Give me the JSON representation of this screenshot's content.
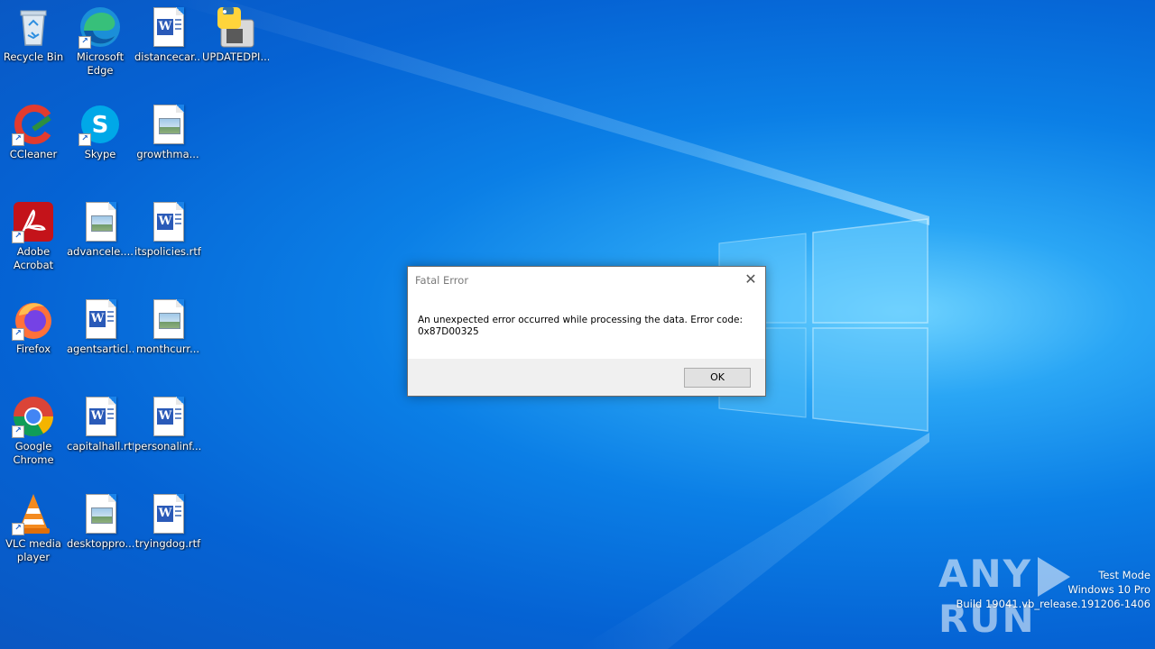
{
  "desktop": {
    "icons": [
      {
        "label": "Recycle Bin",
        "type": "recycle-bin"
      },
      {
        "label": "Microsoft\nEdge",
        "type": "edge"
      },
      {
        "label": "distancecar...",
        "type": "word"
      },
      {
        "label": "UPDATEDPI...",
        "type": "python"
      },
      {
        "label": "CCleaner",
        "type": "ccleaner"
      },
      {
        "label": "Skype",
        "type": "skype"
      },
      {
        "label": "growthma...",
        "type": "image"
      },
      {
        "label": "Adobe\nAcrobat",
        "type": "acrobat"
      },
      {
        "label": "advancele....",
        "type": "image"
      },
      {
        "label": "itspolicies.rtf",
        "type": "word"
      },
      {
        "label": "Firefox",
        "type": "firefox"
      },
      {
        "label": "agentsarticl...",
        "type": "word"
      },
      {
        "label": "monthcurr...",
        "type": "image"
      },
      {
        "label": "Google\nChrome",
        "type": "chrome"
      },
      {
        "label": "capitalhall.rtf",
        "type": "word"
      },
      {
        "label": "personalinf...",
        "type": "word"
      },
      {
        "label": "VLC media\nplayer",
        "type": "vlc"
      },
      {
        "label": "desktoppro...",
        "type": "image"
      },
      {
        "label": "tryingdog.rtf",
        "type": "word"
      }
    ]
  },
  "dialog": {
    "title": "Fatal Error",
    "message_line1": "An unexpected error occurred while processing the data. Error code:",
    "message_line2": "0x87D00325",
    "ok_label": "OK",
    "close_glyph": "✕"
  },
  "watermark": {
    "line1": "Test Mode",
    "line2": "Windows 10 Pro",
    "line3": "Build 19041.vb_release.191206-1406",
    "brand_left": "ANY",
    "brand_right": "RUN"
  }
}
